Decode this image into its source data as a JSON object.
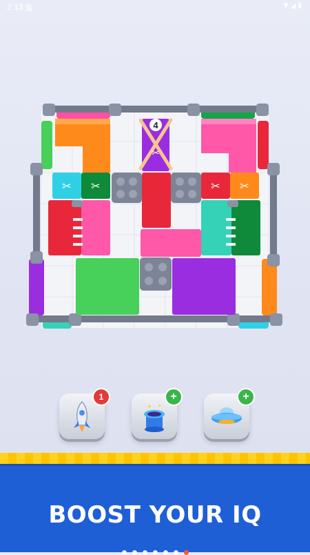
{
  "status_bar": {
    "time": "2:13",
    "notification_glyph": "鬼"
  },
  "board": {
    "counter": "4"
  },
  "powerups": [
    {
      "name": "rocket",
      "badge": "1",
      "badge_type": "count"
    },
    {
      "name": "magic-hat",
      "badge": "+",
      "badge_type": "add"
    },
    {
      "name": "ufo",
      "badge": "+",
      "badge_type": "add"
    }
  ],
  "banner": {
    "title": "BOOST YOUR IQ"
  },
  "pagination": {
    "total": 7,
    "active": 7
  },
  "colors": {
    "banner_blue": "#1f5fd6",
    "stripe_yellow": "#ffd21f",
    "badge_red": "#e23b3b",
    "badge_green": "#3bb54a",
    "active_dot": "#ff5a2a"
  }
}
